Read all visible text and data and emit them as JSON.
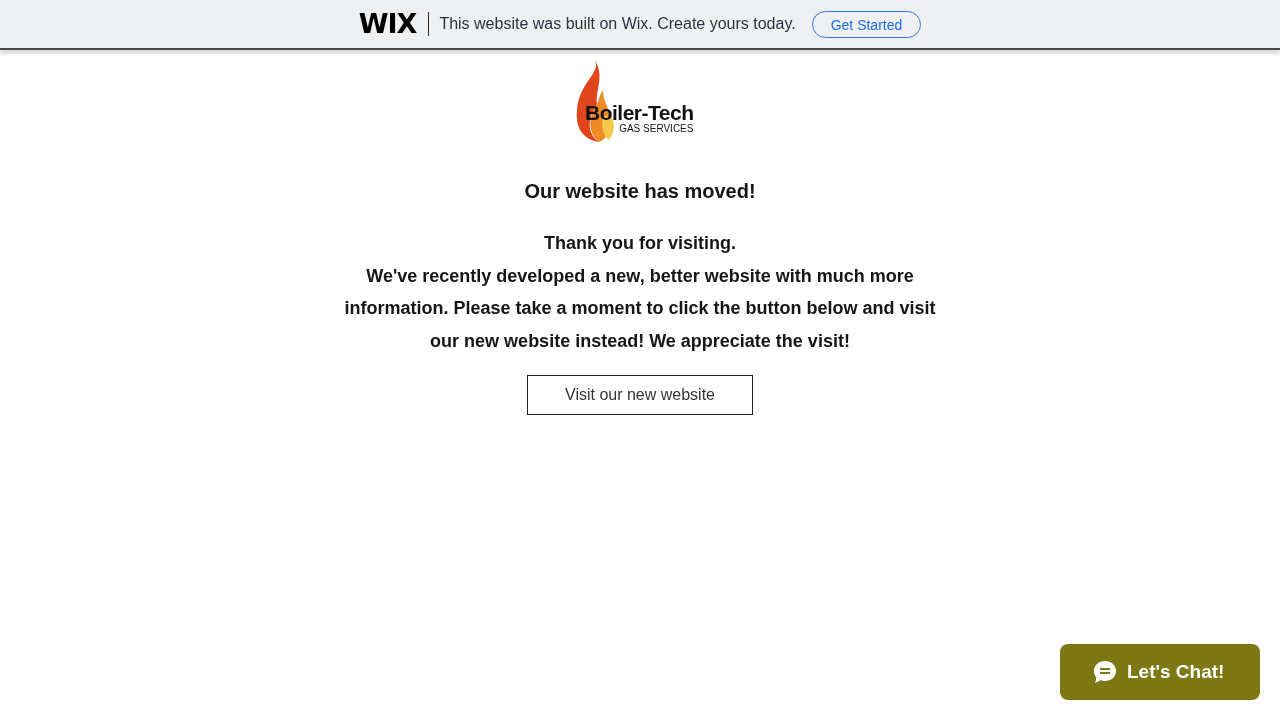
{
  "banner": {
    "logo": "WIX",
    "message": "This website was built on Wix. Create yours today.",
    "button": "Get Started"
  },
  "logo": {
    "name": "Boiler-Tech",
    "tagline": "GAS SERVICES"
  },
  "heading": "Our website has moved!",
  "paragraphs": [
    "Thank you for visiting.",
    "We've recently developed a new, better website with much more information. Please take a moment to click the button below and visit our new website instead! We appreciate the visit!"
  ],
  "button": "Visit our new website",
  "chat": {
    "label": "Let's Chat!"
  }
}
